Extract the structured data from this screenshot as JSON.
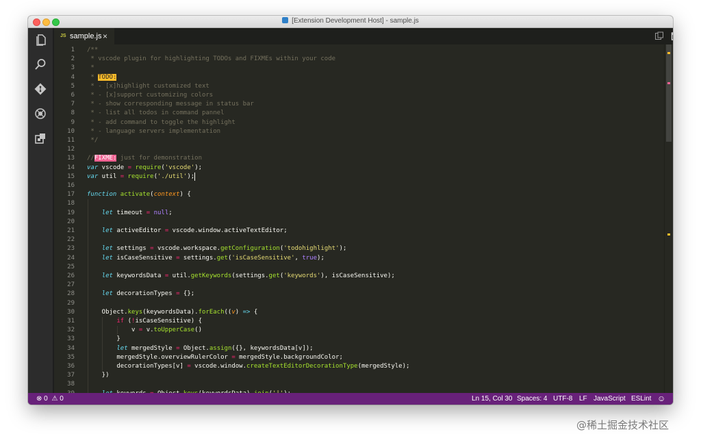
{
  "window": {
    "title": "[Extension Development Host] - sample.js"
  },
  "activity_bar": {
    "icons": [
      "explorer-icon",
      "search-icon",
      "git-icon",
      "debug-icon",
      "extensions-icon"
    ]
  },
  "tab": {
    "lang_badge": "JS",
    "filename": "sample.js",
    "close_glyph": "×"
  },
  "editor": {
    "cursor": {
      "line": 15,
      "col": 30
    },
    "lines": [
      {
        "n": "1",
        "t": [
          {
            "c": "cm",
            "v": "/**"
          }
        ]
      },
      {
        "n": "2",
        "t": [
          {
            "c": "cm",
            "v": " * vscode plugin for highlighting TODOs and FIXMEs within your code"
          }
        ]
      },
      {
        "n": "3",
        "t": [
          {
            "c": "cm",
            "v": " *"
          }
        ]
      },
      {
        "n": "4",
        "t": [
          {
            "c": "cm",
            "v": " * "
          },
          {
            "c": "todo",
            "v": "TODO:"
          }
        ]
      },
      {
        "n": "5",
        "t": [
          {
            "c": "cm",
            "v": " * - [x]highlight customized text"
          }
        ]
      },
      {
        "n": "6",
        "t": [
          {
            "c": "cm",
            "v": " * - [x]support customizing colors"
          }
        ]
      },
      {
        "n": "7",
        "t": [
          {
            "c": "cm",
            "v": " * - show corresponding message in status bar"
          }
        ]
      },
      {
        "n": "8",
        "t": [
          {
            "c": "cm",
            "v": " * - list all todos in command pannel"
          }
        ]
      },
      {
        "n": "9",
        "t": [
          {
            "c": "cm",
            "v": " * - add command to toggle the highlight"
          }
        ]
      },
      {
        "n": "10",
        "t": [
          {
            "c": "cm",
            "v": " * - language servers implementation"
          }
        ]
      },
      {
        "n": "11",
        "t": [
          {
            "c": "cm",
            "v": " */"
          }
        ]
      },
      {
        "n": "12",
        "t": []
      },
      {
        "n": "13",
        "t": [
          {
            "c": "cm",
            "v": "//"
          },
          {
            "c": "fixme",
            "v": "FIXME:"
          },
          {
            "c": "cm",
            "v": " just for demonstration"
          }
        ]
      },
      {
        "n": "14",
        "t": [
          {
            "c": "kw",
            "v": "var"
          },
          {
            "c": "",
            "v": " vscode "
          },
          {
            "c": "op",
            "v": "="
          },
          {
            "c": "",
            "v": " "
          },
          {
            "c": "fn",
            "v": "require"
          },
          {
            "c": "",
            "v": "("
          },
          {
            "c": "str",
            "v": "'vscode'"
          },
          {
            "c": "",
            "v": ");"
          }
        ]
      },
      {
        "n": "15",
        "t": [
          {
            "c": "kw",
            "v": "var"
          },
          {
            "c": "",
            "v": " util "
          },
          {
            "c": "op",
            "v": "="
          },
          {
            "c": "",
            "v": " "
          },
          {
            "c": "fn",
            "v": "require"
          },
          {
            "c": "",
            "v": "("
          },
          {
            "c": "str",
            "v": "'./util'"
          },
          {
            "c": "",
            "v": ");"
          }
        ]
      },
      {
        "n": "16",
        "t": []
      },
      {
        "n": "17",
        "t": [
          {
            "c": "kw",
            "v": "function"
          },
          {
            "c": "",
            "v": " "
          },
          {
            "c": "fn",
            "v": "activate"
          },
          {
            "c": "",
            "v": "("
          },
          {
            "c": "prm",
            "v": "context"
          },
          {
            "c": "",
            "v": ") {"
          }
        ]
      },
      {
        "n": "18",
        "t": []
      },
      {
        "n": "19",
        "t": [
          {
            "c": "",
            "v": "    "
          },
          {
            "c": "kw",
            "v": "let"
          },
          {
            "c": "",
            "v": " timeout "
          },
          {
            "c": "op",
            "v": "="
          },
          {
            "c": "",
            "v": " "
          },
          {
            "c": "num",
            "v": "null"
          },
          {
            "c": "",
            "v": ";"
          }
        ]
      },
      {
        "n": "20",
        "t": []
      },
      {
        "n": "21",
        "t": [
          {
            "c": "",
            "v": "    "
          },
          {
            "c": "kw",
            "v": "let"
          },
          {
            "c": "",
            "v": " activeEditor "
          },
          {
            "c": "op",
            "v": "="
          },
          {
            "c": "",
            "v": " vscode.window.activeTextEditor;"
          }
        ]
      },
      {
        "n": "22",
        "t": []
      },
      {
        "n": "23",
        "t": [
          {
            "c": "",
            "v": "    "
          },
          {
            "c": "kw",
            "v": "let"
          },
          {
            "c": "",
            "v": " settings "
          },
          {
            "c": "op",
            "v": "="
          },
          {
            "c": "",
            "v": " vscode.workspace."
          },
          {
            "c": "fn",
            "v": "getConfiguration"
          },
          {
            "c": "",
            "v": "("
          },
          {
            "c": "str",
            "v": "'todohighlight'"
          },
          {
            "c": "",
            "v": ");"
          }
        ]
      },
      {
        "n": "24",
        "t": [
          {
            "c": "",
            "v": "    "
          },
          {
            "c": "kw",
            "v": "let"
          },
          {
            "c": "",
            "v": " isCaseSensitive "
          },
          {
            "c": "op",
            "v": "="
          },
          {
            "c": "",
            "v": " settings."
          },
          {
            "c": "fn",
            "v": "get"
          },
          {
            "c": "",
            "v": "("
          },
          {
            "c": "str",
            "v": "'isCaseSensitive'"
          },
          {
            "c": "",
            "v": ", "
          },
          {
            "c": "num",
            "v": "true"
          },
          {
            "c": "",
            "v": ");"
          }
        ]
      },
      {
        "n": "25",
        "t": []
      },
      {
        "n": "26",
        "t": [
          {
            "c": "",
            "v": "    "
          },
          {
            "c": "kw",
            "v": "let"
          },
          {
            "c": "",
            "v": " keywordsData "
          },
          {
            "c": "op",
            "v": "="
          },
          {
            "c": "",
            "v": " util."
          },
          {
            "c": "fn",
            "v": "getKeywords"
          },
          {
            "c": "",
            "v": "(settings."
          },
          {
            "c": "fn",
            "v": "get"
          },
          {
            "c": "",
            "v": "("
          },
          {
            "c": "str",
            "v": "'keywords'"
          },
          {
            "c": "",
            "v": "), isCaseSensitive);"
          }
        ]
      },
      {
        "n": "27",
        "t": []
      },
      {
        "n": "28",
        "t": [
          {
            "c": "",
            "v": "    "
          },
          {
            "c": "kw",
            "v": "let"
          },
          {
            "c": "",
            "v": " decorationTypes "
          },
          {
            "c": "op",
            "v": "="
          },
          {
            "c": "",
            "v": " {};"
          }
        ]
      },
      {
        "n": "29",
        "t": []
      },
      {
        "n": "30",
        "t": [
          {
            "c": "",
            "v": "    Object."
          },
          {
            "c": "fn",
            "v": "keys"
          },
          {
            "c": "",
            "v": "(keywordsData)."
          },
          {
            "c": "fn",
            "v": "forEach"
          },
          {
            "c": "",
            "v": "(("
          },
          {
            "c": "prm",
            "v": "v"
          },
          {
            "c": "",
            "v": ") "
          },
          {
            "c": "kw",
            "v": "=>"
          },
          {
            "c": "",
            "v": " {"
          }
        ]
      },
      {
        "n": "31",
        "t": [
          {
            "c": "",
            "v": "        "
          },
          {
            "c": "op",
            "v": "if"
          },
          {
            "c": "",
            "v": " ("
          },
          {
            "c": "op",
            "v": "!"
          },
          {
            "c": "",
            "v": "isCaseSensitive) {"
          }
        ]
      },
      {
        "n": "32",
        "t": [
          {
            "c": "",
            "v": "            v "
          },
          {
            "c": "op",
            "v": "="
          },
          {
            "c": "",
            "v": " v."
          },
          {
            "c": "fn",
            "v": "toUpperCase"
          },
          {
            "c": "",
            "v": "()"
          }
        ]
      },
      {
        "n": "33",
        "t": [
          {
            "c": "",
            "v": "        }"
          }
        ]
      },
      {
        "n": "34",
        "t": [
          {
            "c": "",
            "v": "        "
          },
          {
            "c": "kw",
            "v": "let"
          },
          {
            "c": "",
            "v": " mergedStyle "
          },
          {
            "c": "op",
            "v": "="
          },
          {
            "c": "",
            "v": " Object."
          },
          {
            "c": "fn",
            "v": "assign"
          },
          {
            "c": "",
            "v": "({}, keywordsData[v]);"
          }
        ]
      },
      {
        "n": "35",
        "t": [
          {
            "c": "",
            "v": "        mergedStyle.overviewRulerColor "
          },
          {
            "c": "op",
            "v": "="
          },
          {
            "c": "",
            "v": " mergedStyle.backgroundColor;"
          }
        ]
      },
      {
        "n": "36",
        "t": [
          {
            "c": "",
            "v": "        decorationTypes[v] "
          },
          {
            "c": "op",
            "v": "="
          },
          {
            "c": "",
            "v": " vscode.window."
          },
          {
            "c": "fn",
            "v": "createTextEditorDecorationType"
          },
          {
            "c": "",
            "v": "(mergedStyle);"
          }
        ]
      },
      {
        "n": "37",
        "t": [
          {
            "c": "",
            "v": "    })"
          }
        ]
      },
      {
        "n": "38",
        "t": []
      },
      {
        "n": "39",
        "t": [
          {
            "c": "",
            "v": "    "
          },
          {
            "c": "kw",
            "v": "let"
          },
          {
            "c": "",
            "v": " keywords "
          },
          {
            "c": "op",
            "v": "="
          },
          {
            "c": "",
            "v": " Object."
          },
          {
            "c": "fn",
            "v": "keys"
          },
          {
            "c": "",
            "v": "(keywordsData)."
          },
          {
            "c": "fn",
            "v": "join"
          },
          {
            "c": "",
            "v": "("
          },
          {
            "c": "str",
            "v": "'|'"
          },
          {
            "c": "",
            "v": ");"
          }
        ]
      }
    ]
  },
  "status_bar": {
    "errors": "0",
    "warnings": "0",
    "position": "Ln 15, Col 30",
    "indent": "Spaces: 4",
    "encoding": "UTF-8",
    "eol": "LF",
    "language": "JavaScript",
    "linter": "ESLint"
  },
  "watermark": "@稀土掘金技术社区",
  "colors": {
    "editor_bg": "#272822",
    "status_bar": "#68217a",
    "todo_highlight": "#ffbd2a",
    "fixme_highlight": "#f06292"
  }
}
